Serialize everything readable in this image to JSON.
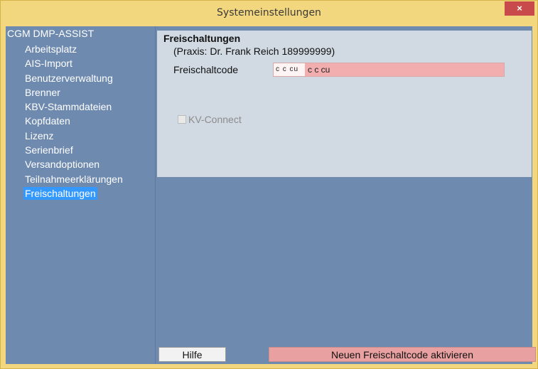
{
  "window": {
    "title": "Systemeinstellungen",
    "close_label": "×"
  },
  "tree": {
    "root": "CGM DMP-ASSIST",
    "items": [
      {
        "label": "Arbeitsplatz"
      },
      {
        "label": "AIS-Import"
      },
      {
        "label": "Benutzerverwaltung"
      },
      {
        "label": "Brenner"
      },
      {
        "label": "KBV-Stammdateien"
      },
      {
        "label": "Kopfdaten"
      },
      {
        "label": "Lizenz"
      },
      {
        "label": "Serienbrief"
      },
      {
        "label": "Versandoptionen"
      },
      {
        "label": "Teilnahmeerklärungen"
      },
      {
        "label": "Freischaltungen"
      }
    ],
    "selected_index": 10
  },
  "panel": {
    "title": "Freischaltungen",
    "praxis": "(Praxis: Dr. Frank Reich 189999999)",
    "code_label": "Freischaltcode",
    "code_value": "c c cu",
    "kv_label": "KV-Connect",
    "kv_checked": false
  },
  "buttons": {
    "help": "Hilfe",
    "activate": "Neuen Freischaltcode aktivieren"
  },
  "colors": {
    "titlebar": "#f3d77f",
    "client_bg": "#6e8aaf",
    "panel_bg": "#d1d9e3",
    "selection": "#3399ff",
    "code_field": "#f2aeae",
    "activate_button": "#e8a0a0",
    "close_button": "#c84a4a"
  }
}
